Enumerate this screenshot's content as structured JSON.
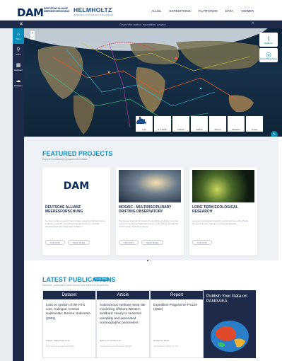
{
  "header": {
    "logo_main": "DAM",
    "logo_sub": "DEUTSCHE ALLIANZ MEERESFORSCHUNG",
    "helmholtz": "HELMHOLTZ",
    "helmholtz_sub": "RESEARCH FOR GRAND CHALLENGES",
    "nav": [
      "ALUSL",
      "EXPEDITIONS",
      "PLATFORMS",
      "DATA",
      "VIEWER"
    ]
  },
  "search": {
    "placeholder": "Search for author, expedition, project.....",
    "close": "✕",
    "clear": "✕"
  },
  "sidebar": {
    "items": [
      {
        "label": "Home",
        "icon": "home-icon",
        "glyph": "⌂"
      },
      {
        "label": "Search",
        "icon": "search-icon",
        "glyph": "⚲"
      },
      {
        "label": "Dashboard",
        "icon": "dashboard-icon",
        "glyph": "▦"
      },
      {
        "label": "Workspace",
        "icon": "cloud-icon",
        "glyph": "☁"
      }
    ]
  },
  "map": {
    "zoom_in": "+",
    "zoom_out": "−",
    "cards": [
      {
        "label": "SeaRover",
        "icon": "signal-waves-icon"
      },
      {
        "label": "Ocean Observatory",
        "icon": "broadcast-icon"
      }
    ],
    "platforms": [
      "Argo",
      "E. Antarctic",
      "Vehicles",
      "Stations",
      "Moored",
      "Polarstern",
      "Cruises"
    ],
    "chat_glyph": "✎",
    "colors": {
      "ocean": "#1c3a55",
      "land": "#9a8a6a",
      "ice": "#dfe7ee"
    }
  },
  "featured": {
    "title": "FEATURED PROJECTS",
    "subtitle": "Explore thematically grouped information",
    "cards": [
      {
        "title": "DEUTSCHE ALLIANZ MEERESFORSCHUNG",
        "desc": "German marine research has a unique network of infrastructure, including research vessels and research stations, aircraft, observatories and underwater vehicles.",
        "buttons": [
          "FIND DATA",
          "READ MORE"
        ]
      },
      {
        "title": "MOSAIC - MULTIDISCIPLINARY DRIFTING OBSERVATORY",
        "desc": "The largest scale Arctic research expedition of all time, German research icebreaker Polarstern spent a year drifting through the Arctic Ocean, trapped in the ice.",
        "buttons": [
          "FIND DATA",
          "READ MORE"
        ]
      },
      {
        "title": "LONG TERM ECOLOGICAL RESEARCH",
        "desc": "Long-term ecological research monitors among other things impact of climate change to ecological diversity.",
        "buttons": [
          "FIND DATA"
        ]
      }
    ]
  },
  "publications": {
    "title": "LATEST PUBLICATIONS",
    "badge": "SHOW MORE",
    "subtitle": "Datasets, publications and reports from different repositories",
    "items": [
      {
        "type": "Dataset",
        "title": "Loss on ignition of the KTG core, Kalingan, Central Kalimantan, Borneo, Indonesia (2022)",
        "author": "Kayani, Katka Kepp et al.",
        "link": "https://doi.pangaea.de/10.1594/PA"
      },
      {
        "type": "Article",
        "title": "Autonomous methane seep site monitoring offshore Western Svalbard: Hourly to seasonal variability and associated oceanographic parameters",
        "author": "Dølven, Knut Ola et al.",
        "link": "www.frontiersin.org/articles/10.3389/FM"
      },
      {
        "type": "Report",
        "title": "Expedition Programme PS129 (2022)",
        "author": "Hoppema, Mario",
        "link": "hdl:10013/epic.0@PUnJvc1lz0"
      }
    ],
    "pangaea": {
      "title": "Publish Your Data on PANGAEA"
    }
  }
}
